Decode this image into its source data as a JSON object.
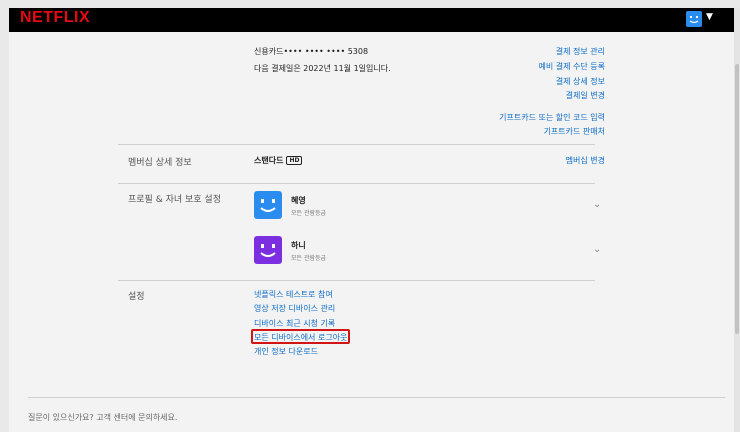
{
  "brand": {
    "logo_text": "NETFLIX",
    "accent": "#e50914"
  },
  "header": {
    "avatar_icon": "smile-face-icon",
    "caret_icon": "caret-down-icon"
  },
  "billing": {
    "card_label": "신용카드",
    "card_masked": "•••• •••• •••• 5308",
    "next_payment": "다음 결제일은 2022년 11월 1일입니다.",
    "links": [
      "결제 정보 관리",
      "예비 결제 수단 등록",
      "결제 상세 정보",
      "결제일 변경"
    ],
    "gift_links": [
      "기프트카드 또는 할인 코드 입력",
      "기프트카드 판매처"
    ]
  },
  "membership": {
    "section_label": "멤버십 상세 정보",
    "plan": "스탠다드",
    "plan_badge": "HD",
    "change_link": "멤버십 변경"
  },
  "profiles": {
    "section_label": "프로필 & 자녀 보호 설정",
    "items": [
      {
        "name": "혜영",
        "rating": "모든 관람등급",
        "color": "#2b8cf0"
      },
      {
        "name": "하니",
        "rating": "모든 관람등급",
        "color": "#7b2fe0"
      }
    ]
  },
  "settings": {
    "section_label": "설정",
    "links": [
      "넷플릭스 테스트로 참여",
      "영상 저장 디바이스 관리",
      "디바이스 최근 시청 기록",
      "모든 디바이스에서 로그아웃",
      "개인 정보 다운로드"
    ],
    "highlight_color": "#d21414"
  },
  "footer": {
    "help_text": "질문이 있으신가요? 고객 센터에 문의하세요."
  }
}
